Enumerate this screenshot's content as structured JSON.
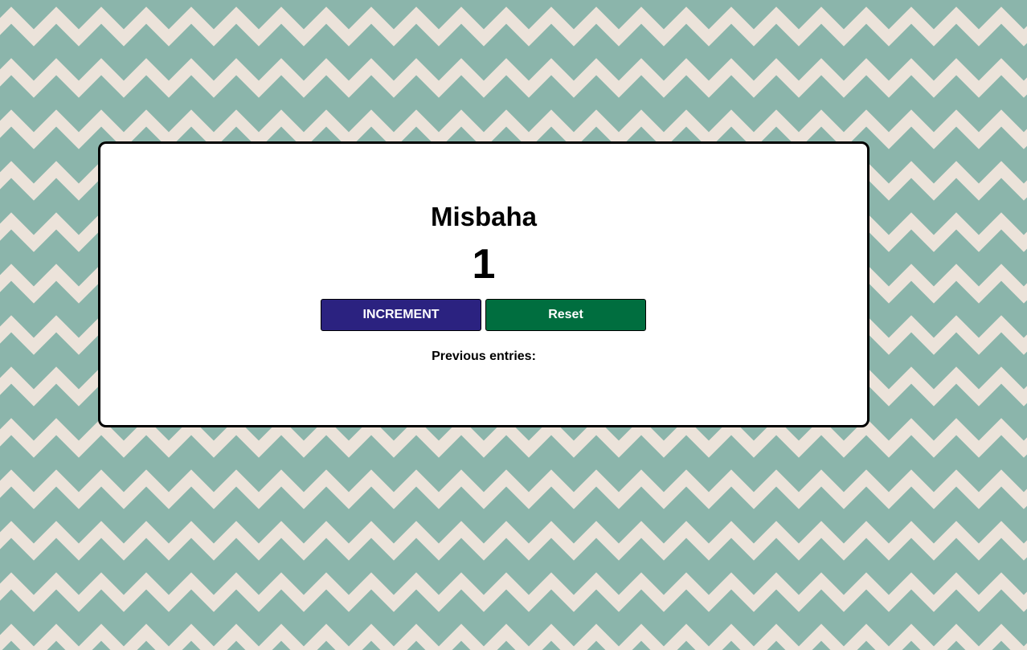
{
  "app": {
    "title": "Misbaha",
    "counter_value": "1"
  },
  "buttons": {
    "increment_label": "INCREMENT",
    "reset_label": "Reset"
  },
  "history": {
    "label": "Previous entries:",
    "entries": []
  },
  "colors": {
    "background_teal": "#8bb5ab",
    "background_zigzag": "#ece3da",
    "card": "#ffffff",
    "increment_button": "#2b2280",
    "reset_button": "#006e3f"
  }
}
